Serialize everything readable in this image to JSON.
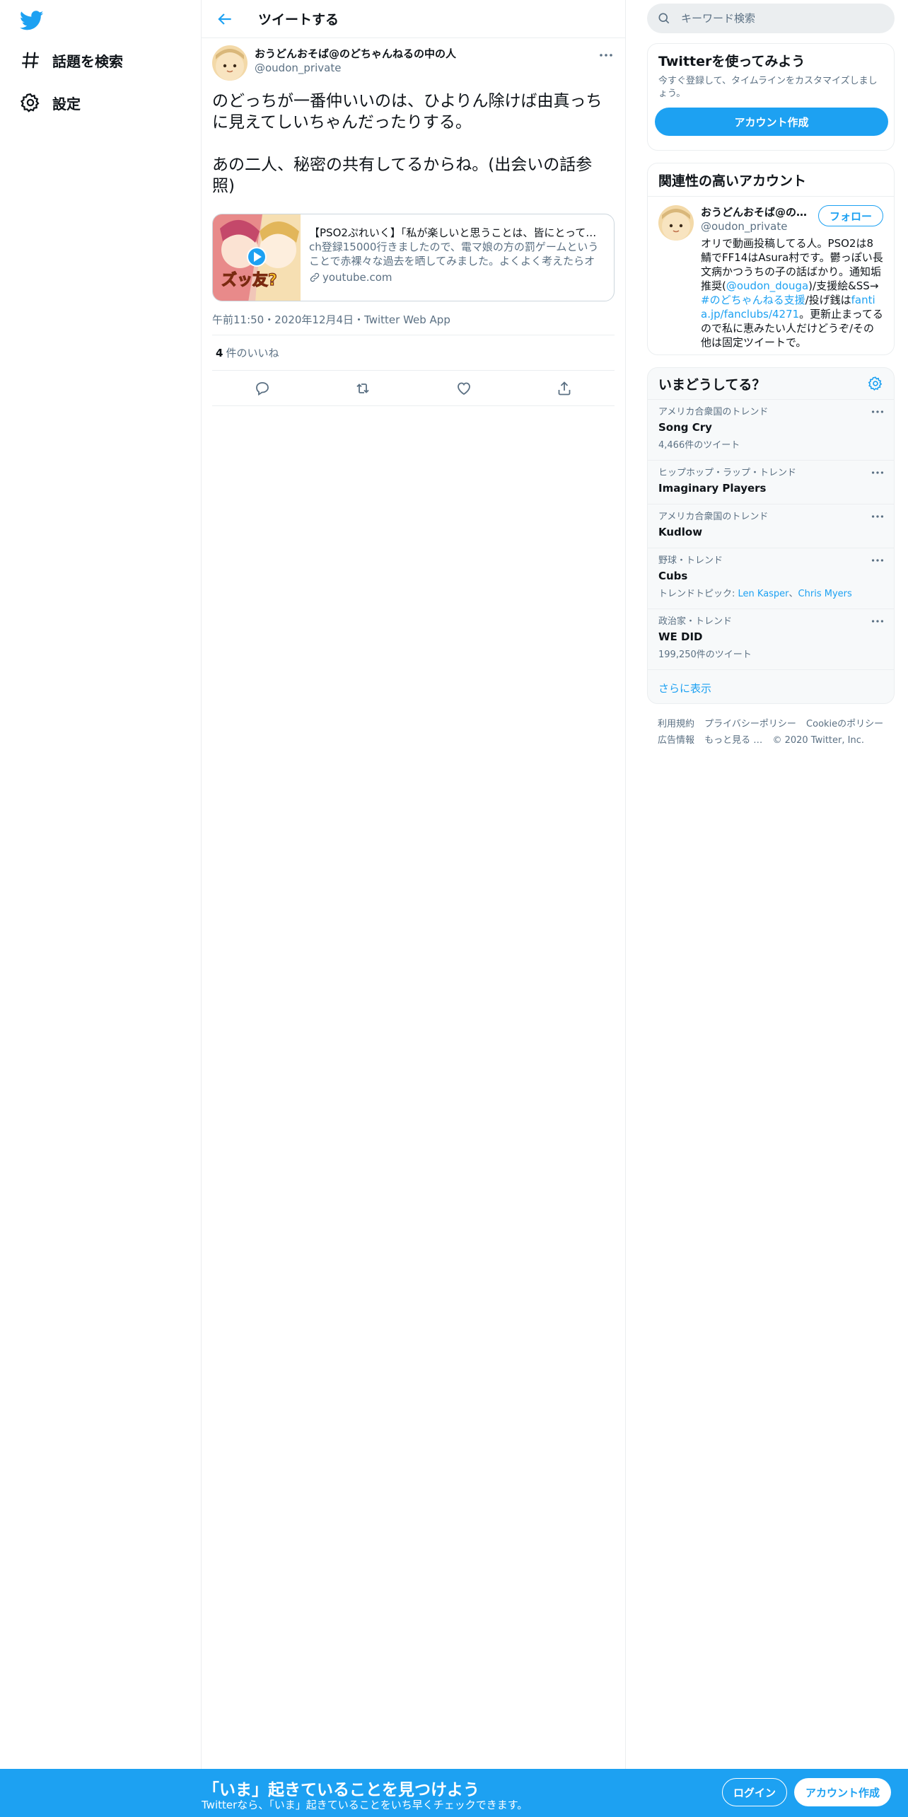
{
  "nav": {
    "explore_label": "話題を検索",
    "settings_label": "設定"
  },
  "header": {
    "title": "ツイートする"
  },
  "tweet": {
    "display_name": "おうどんおそば@のどちゃんねるの中の人",
    "handle": "@oudon_private",
    "body": "のどっちが一番仲いいのは、ひよりん除けば由真っちに見えてしいちゃんだったりする。\n\nあの二人、秘密の共有してるからね。(出会いの話参照)",
    "card": {
      "title": "【PSO2ぷれいく】「私が楽しいと思うことは、皆にとって…",
      "description": "ch登録15000行きましたので、電マ娘の方の罰ゲームということで赤裸々な過去を晒してみました。よくよく考えたらオリ…",
      "domain": "youtube.com",
      "thumb_text": "ズッ友?"
    },
    "timestamp": "午前11:50・2020年12月4日・Twitter Web App",
    "likes_count": "4",
    "likes_label": "件のいいね"
  },
  "search": {
    "placeholder": "キーワード検索"
  },
  "signup_box": {
    "title": "Twitterを使ってみよう",
    "subtitle": "今すぐ登録して、タイムラインをカスタマイズしましょう。",
    "button": "アカウント作成"
  },
  "relevant": {
    "title": "関連性の高いアカウント",
    "display_name": "おうどんおそば@の…",
    "handle": "@oudon_private",
    "follow": "フォロー",
    "bio_1": "オリで動画投稿してる人。PSO2は8鯖でFF14はAsura村です。鬱っぽい長文病かつうちの子の話ばかり。通知垢推奨(",
    "bio_link1": "@oudon_douga",
    "bio_2": ")/支援絵&SS→",
    "bio_link2": "#のどちゃんねる支援",
    "bio_3": "/投げ銭は",
    "bio_link3": "fantia.jp/fanclubs/4271",
    "bio_4": "。更新止まってるので私に恵みたい人だけどうぞ/その他は固定ツイートで。"
  },
  "trends": {
    "title": "いまどうしてる？",
    "items": [
      {
        "category": "アメリカ合衆国のトレンド",
        "name": "Song Cry",
        "count": "4,466件のツイート"
      },
      {
        "category": "ヒップホップ・ラップ・トレンド",
        "name": "Imaginary Players",
        "count": ""
      },
      {
        "category": "アメリカ合衆国のトレンド",
        "name": "Kudlow",
        "count": ""
      },
      {
        "category": "野球・トレンド",
        "name": "Cubs",
        "topic_label": "トレンドトピック: ",
        "topic_1": "Len Kasper",
        "topic_sep": "、",
        "topic_2": "Chris Myers"
      },
      {
        "category": "政治家・トレンド",
        "name": "WE DID",
        "count": "199,250件のツイート"
      }
    ],
    "show_more": "さらに表示"
  },
  "footer": {
    "terms": "利用規約",
    "privacy": "プライバシーポリシー",
    "cookie": "Cookieのポリシー",
    "ads": "広告情報",
    "more": "もっと見る …",
    "copyright": "© 2020 Twitter, Inc."
  },
  "bottom_bar": {
    "headline": "「いま」起きていることを見つけよう",
    "sub": "Twitterなら、「いま」起きていることをいち早くチェックできます。",
    "login": "ログイン",
    "signup": "アカウント作成"
  },
  "colors": {
    "accent": "#1da1f2",
    "text": "#0f1419",
    "secondary": "#5b7083"
  }
}
